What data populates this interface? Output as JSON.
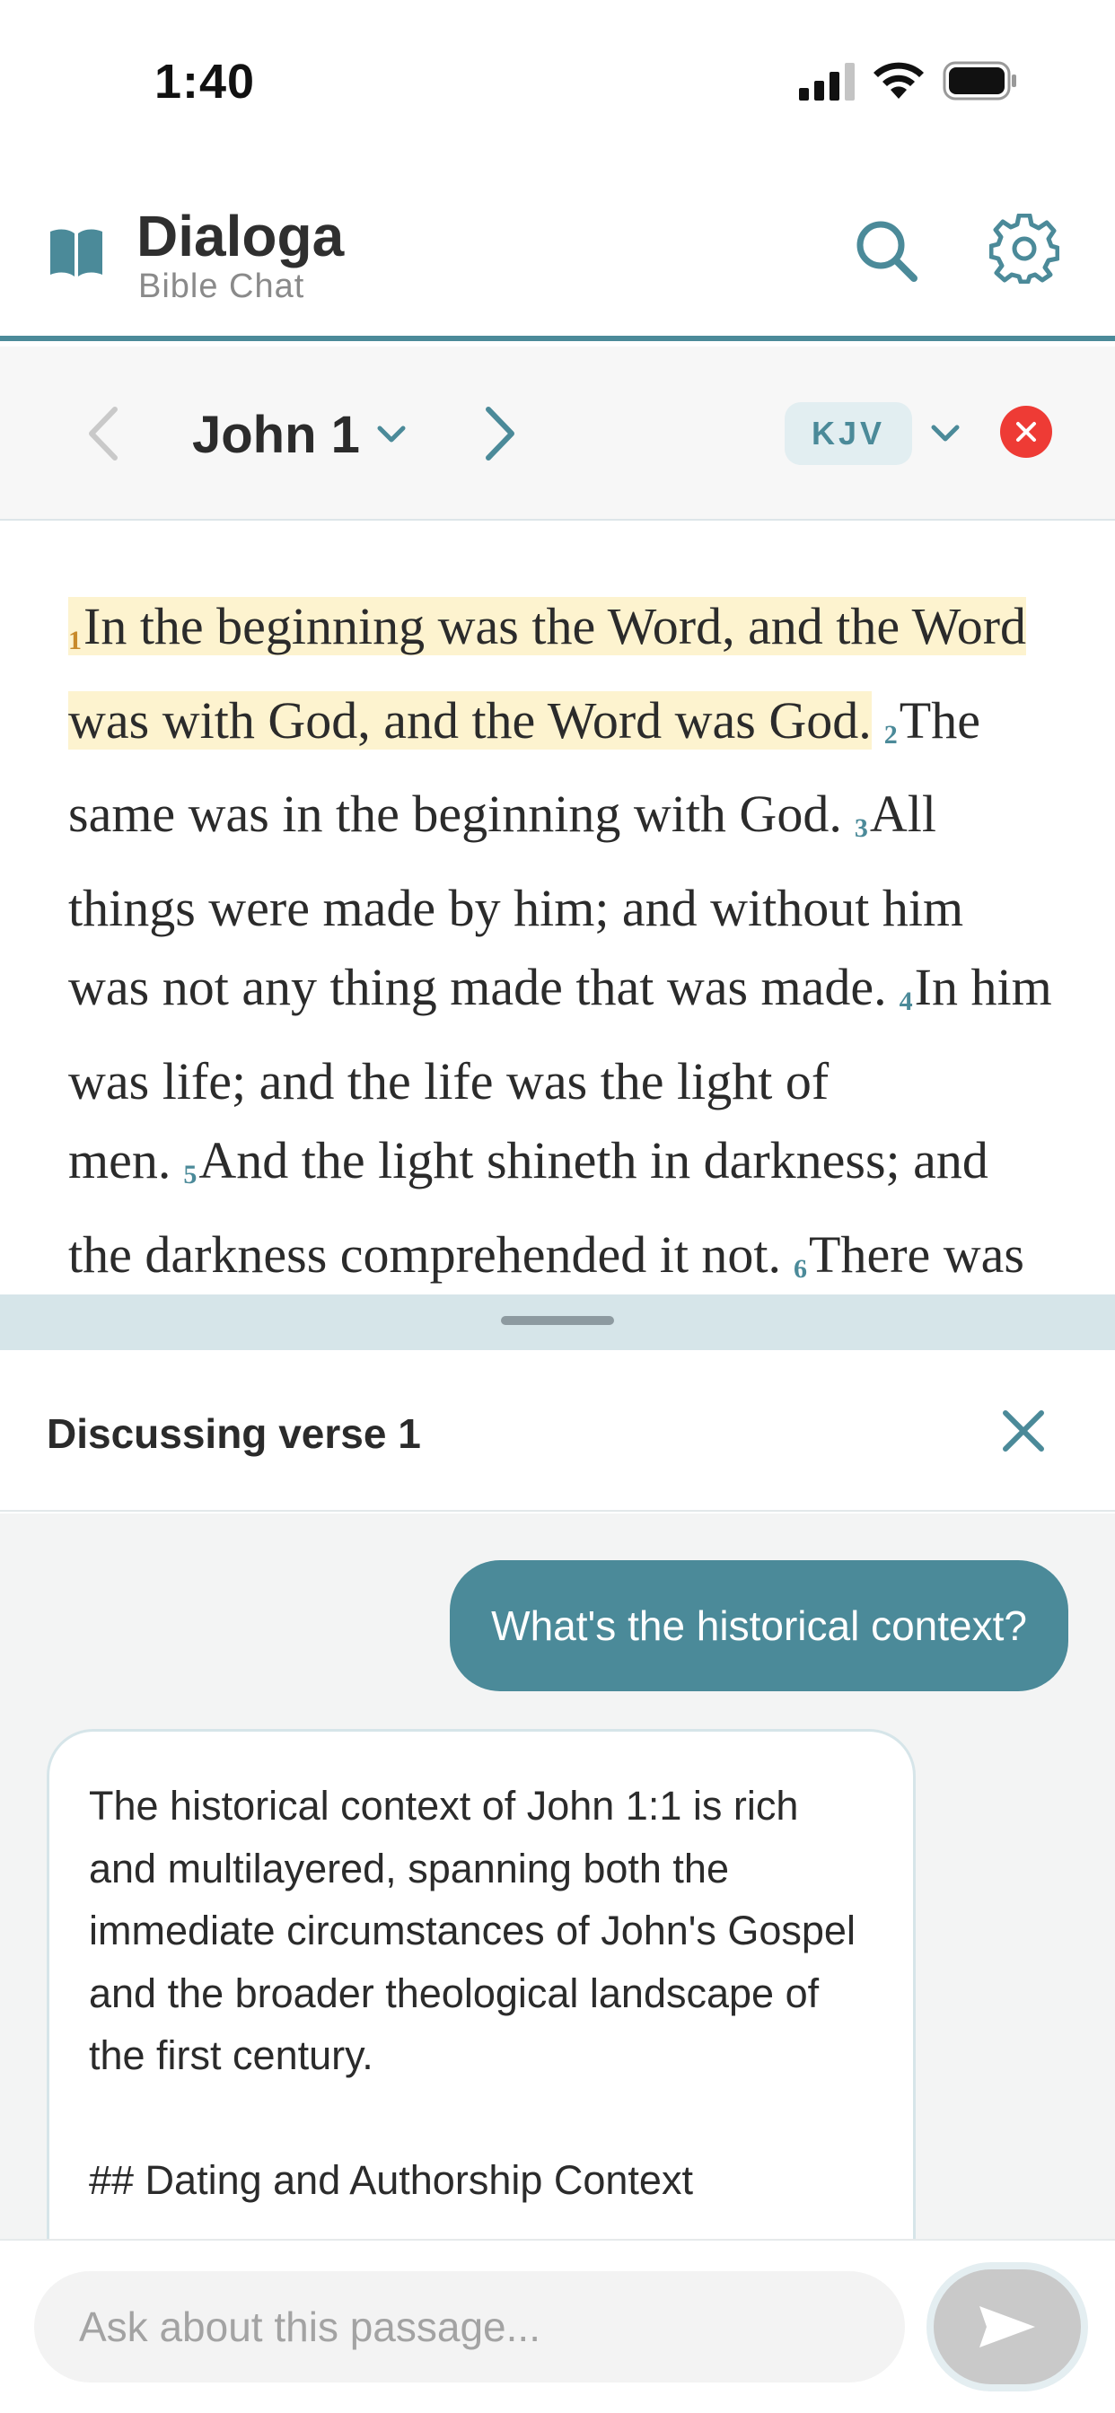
{
  "status_bar": {
    "time": "1:40"
  },
  "header": {
    "title": "Dialoga",
    "subtitle": "Bible Chat"
  },
  "reader_nav": {
    "chapter": "John 1",
    "version": "KJV"
  },
  "scripture": {
    "verses": [
      {
        "num": "1",
        "text": "In the beginning was the Word, and the Word was with God, and the Word was God."
      },
      {
        "num": "2",
        "text": "The same was in the beginning with God."
      },
      {
        "num": "3",
        "text": "All things were made by him; and without him was not any thing made that was made."
      },
      {
        "num": "4",
        "text": "In him was life; and the life was the light of men."
      },
      {
        "num": "5",
        "text": "And the light shineth in darkness; and the darkness comprehended it not."
      },
      {
        "num": "6",
        "text": "There was a man"
      }
    ]
  },
  "discussion": {
    "title": "Discussing verse 1"
  },
  "chat": {
    "user_message": "What's the historical context?",
    "assistant_message": {
      "paragraph_1": "The historical context of John 1:1 is rich and multilayered, spanning both the immediate circumstances of John's Gospel and the broader theological landscape of the first century.",
      "paragraph_2": "## Dating and Authorship Context"
    }
  },
  "input": {
    "placeholder": "Ask about this passage..."
  },
  "colors": {
    "accent": "#4b8a99",
    "highlight": "#fdf3cf",
    "close_red": "#ee3b35",
    "send_disabled": "#c9c9c9"
  },
  "icons": {
    "logo": "open-book-icon",
    "search": "search-icon",
    "settings": "gear-icon",
    "prev": "chevron-left-icon",
    "next": "chevron-right-icon",
    "dropdown": "chevron-down-icon",
    "close_reader": "close-circle-icon",
    "close_discussion": "close-icon",
    "send": "send-icon"
  }
}
